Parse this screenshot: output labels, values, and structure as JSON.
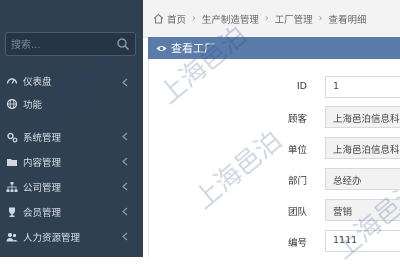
{
  "sidebar": {
    "search_placeholder": "搜索...",
    "items": [
      {
        "label": "仪表盘",
        "icon": "dashboard-icon",
        "has_chevron": true
      },
      {
        "label": "功能",
        "icon": "globe-icon",
        "has_chevron": false
      },
      {
        "label": "系统管理",
        "icon": "gears-icon",
        "has_chevron": true
      },
      {
        "label": "内容管理",
        "icon": "folder-icon",
        "has_chevron": true
      },
      {
        "label": "公司管理",
        "icon": "sitemap-icon",
        "has_chevron": true
      },
      {
        "label": "会员管理",
        "icon": "trophy-icon",
        "has_chevron": true
      },
      {
        "label": "人力资源管理",
        "icon": "users-icon",
        "has_chevron": true
      }
    ]
  },
  "breadcrumb": [
    "首页",
    "生产制造管理",
    "工厂管理",
    "查看明细"
  ],
  "panel": {
    "title": "查看工厂"
  },
  "form": [
    {
      "label": "ID",
      "value": "1"
    },
    {
      "label": "顾客",
      "value": "上海邑泊信息科技"
    },
    {
      "label": "单位",
      "value": "上海邑泊信息科技"
    },
    {
      "label": "部门",
      "value": "总经办"
    },
    {
      "label": "团队",
      "value": "营销"
    },
    {
      "label": "编号",
      "value": "1111"
    }
  ],
  "watermark": "上海邑泊",
  "colors": {
    "sidebar": "#2f4050",
    "panel_header": "#5b7ba8"
  }
}
